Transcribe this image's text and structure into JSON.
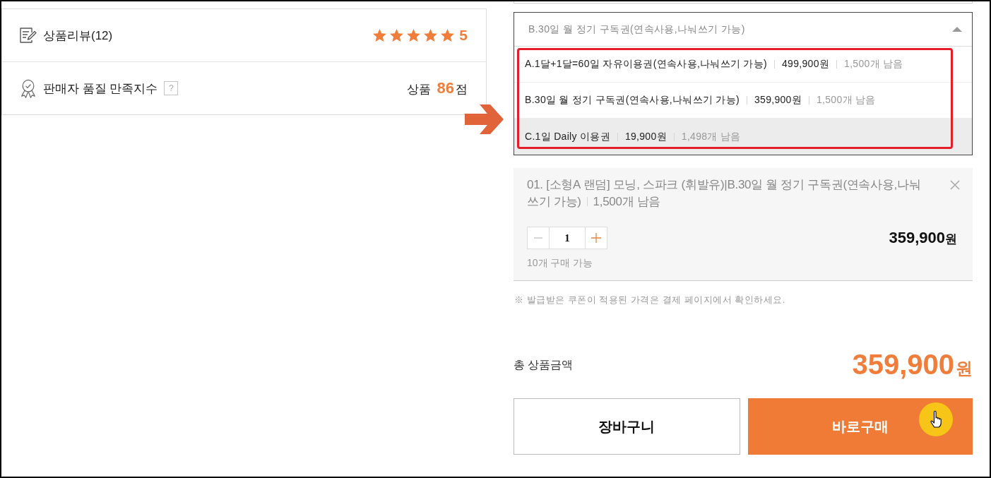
{
  "summary": {
    "rows": [
      {
        "kind": "review",
        "label": "상품리뷰(12)",
        "stars": 5,
        "score": "5"
      },
      {
        "kind": "seller",
        "label": "판매자 품질 만족지수",
        "help": "?",
        "prefix": "상품",
        "score": "86",
        "suffix": "점"
      }
    ]
  },
  "option_select": {
    "value": "B.30일 월 정기 구독권(연속사용,나눠쓰기 가능)",
    "expanded": true,
    "options": [
      {
        "name": "A.1달+1달=60일 자유이용권(연속사용,나눠쓰기 가능)",
        "price": "499,900원",
        "stock": "1,500개 남음",
        "highlighted": false
      },
      {
        "name": "B.30일 월 정기 구독권(연속사용,나눠쓰기 가능)",
        "price": "359,900원",
        "stock": "1,500개 남음",
        "highlighted": false
      },
      {
        "name": "C.1일 Daily 이용권",
        "price": "19,900원",
        "stock": "1,498개 남음",
        "highlighted": true
      }
    ]
  },
  "annotation": {
    "outline_options": true,
    "arrow": true
  },
  "selected_items": [
    {
      "title": "01. [소형A 랜덤] 모닝, 스파크 (휘발유)|B.30일 월 정기 구독권(연속사용,나눠쓰기 가능)",
      "stock": "1,500개 남음",
      "quantity": "1",
      "price": "359,900",
      "currency": "원",
      "limit": "10개 구매 가능"
    }
  ],
  "notice": "※ 발급받은 쿠폰이 적용된 가격은 결제 페이지에서 확인하세요.",
  "total": {
    "label": "총 상품금액",
    "amount": "359,900",
    "currency": "원"
  },
  "buttons": [
    {
      "kind": "cart",
      "label": "장바구니",
      "cursor": false
    },
    {
      "kind": "buy",
      "label": "바로구매",
      "cursor": true
    }
  ]
}
